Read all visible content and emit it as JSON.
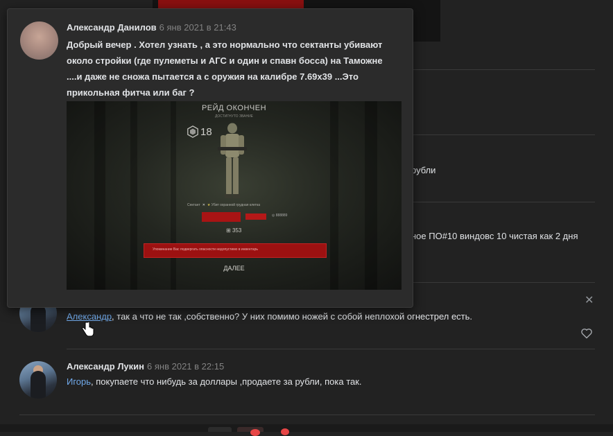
{
  "background_comments": {
    "fragment_1": "рубли",
    "fragment_2": "ное ПО#10 виндовс 10 чистая как 2 дня"
  },
  "reply_comment": {
    "mention": "Александр",
    "text": ", так а что не так ,собственно? У них помимо ножей с собой неплохой огнестрел есть."
  },
  "last_comment": {
    "author": "Александр Лукин",
    "date": "6 янв 2021 в 22:15",
    "mention": "Игорь",
    "text": ", покупаете что нибудь за доллары ,продаете за рубли, пока так."
  },
  "popup": {
    "author": "Александр Данилов",
    "date": "6 янв 2021 в 21:43",
    "lines": [
      "Добрый вечер . Хотел узнать , а это нормально что сектанты убивают",
      "около стройки (где пулеметы и АГС и один и спавн босса) на Таможне",
      "....и даже не сножа пытается а с оружия на калибре 7.69х39 ...Это",
      "прикольная фитча или баг ?"
    ],
    "screenshot": {
      "title": "РЕЙД ОКОНЧЕН",
      "subtitle": "ДОСТИГНУТО ЗВАНИЕ",
      "level": "18",
      "killer_label": "Сектант",
      "killer_info": "Убит охранной грудная клетка",
      "damage_value": "888889",
      "score": "353",
      "banner_text": "Упоминание Вас подвергать опасности недопустимо в инвентарь",
      "next_button": "ДАЛЕЕ"
    }
  },
  "icons": {
    "close": "close-icon",
    "like": "heart-icon",
    "cursor": "hand-pointer-icon"
  },
  "colors": {
    "background": "#222222",
    "link": "#71aaeb",
    "date": "#828282",
    "alert_red": "#e64646"
  }
}
